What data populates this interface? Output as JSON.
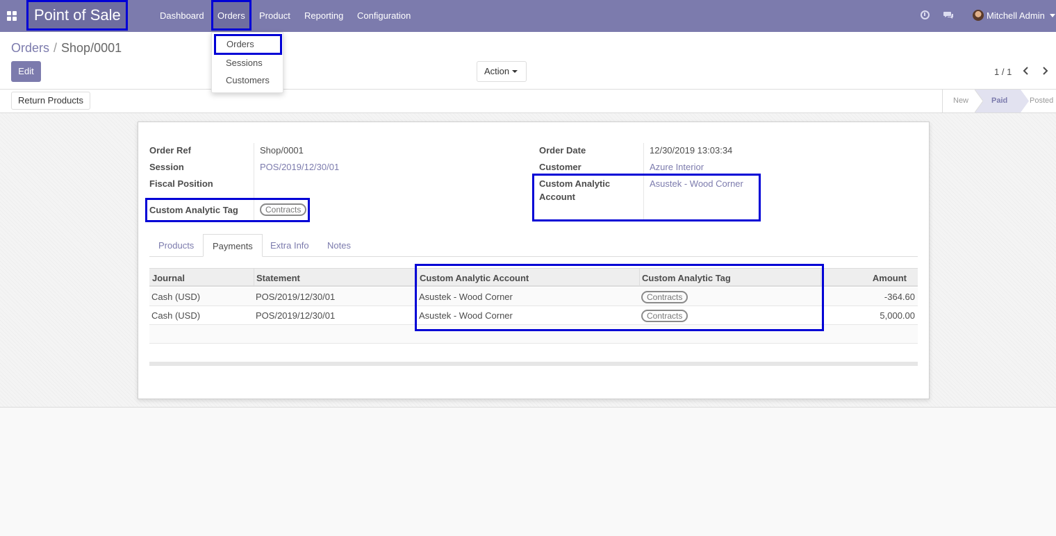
{
  "navbar": {
    "app_title": "Point of Sale",
    "menus": [
      "Dashboard",
      "Orders",
      "Product",
      "Reporting",
      "Configuration"
    ],
    "active_menu": "Orders",
    "user_name": "Mitchell Admin",
    "icons": [
      "apps-icon",
      "clock-icon",
      "chat-icon",
      "avatar"
    ]
  },
  "dropdown": {
    "items": [
      "Orders",
      "Sessions",
      "Customers"
    ],
    "selected": "Orders"
  },
  "control_panel": {
    "breadcrumb_parent": "Orders",
    "breadcrumb_separator": "/",
    "breadcrumb_current": "Shop/0001",
    "edit_label": "Edit",
    "action_label": "Action",
    "pager": "1 / 1"
  },
  "statusbar": {
    "return_label": "Return Products",
    "stages": [
      "New",
      "Paid",
      "Posted"
    ],
    "active_stage": "Paid"
  },
  "form": {
    "order_ref_label": "Order Ref",
    "order_ref": "Shop/0001",
    "session_label": "Session",
    "session": "POS/2019/12/30/01",
    "fiscal_position_label": "Fiscal Position",
    "fiscal_position": "",
    "analytic_tag_label": "Custom Analytic Tag",
    "analytic_tag": "Contracts",
    "order_date_label": "Order Date",
    "order_date": "12/30/2019 13:03:34",
    "customer_label": "Customer",
    "customer": "Azure Interior",
    "analytic_account_label_1": "Custom Analytic",
    "analytic_account_label_2": "Account",
    "analytic_account": "Asustek - Wood Corner"
  },
  "tabs": [
    "Products",
    "Payments",
    "Extra Info",
    "Notes"
  ],
  "active_tab": "Payments",
  "payments_table": {
    "columns": [
      "Journal",
      "Statement",
      "Custom Analytic Account",
      "Custom Analytic Tag",
      "Amount"
    ],
    "rows": [
      {
        "journal": "Cash (USD)",
        "statement": "POS/2019/12/30/01",
        "account": "Asustek - Wood Corner",
        "tag": "Contracts",
        "amount": "-364.60"
      },
      {
        "journal": "Cash (USD)",
        "statement": "POS/2019/12/30/01",
        "account": "Asustek - Wood Corner",
        "tag": "Contracts",
        "amount": "5,000.00"
      }
    ]
  },
  "colors": {
    "brand": "#7c7bad",
    "highlight_box": "#0000d6"
  }
}
